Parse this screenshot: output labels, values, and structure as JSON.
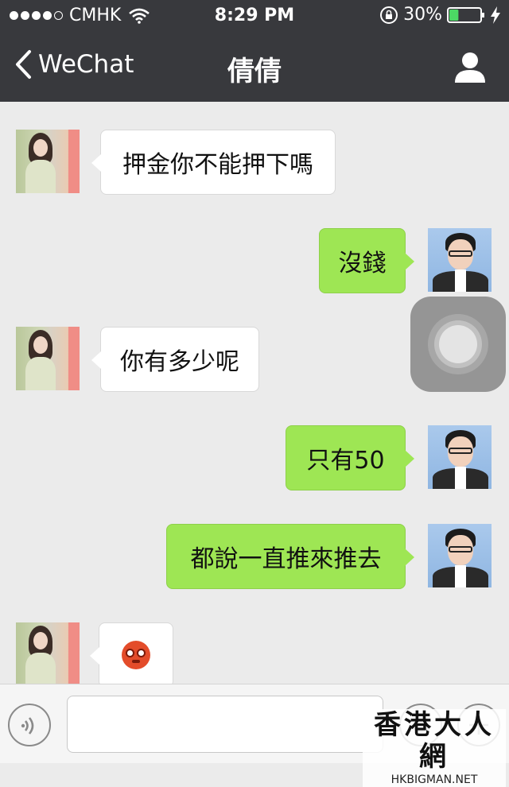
{
  "status_bar": {
    "signal_dots_filled": 4,
    "signal_dots_total": 5,
    "carrier": "CMHK",
    "time": "8:29 PM",
    "battery_percent": "30%",
    "battery_level": 0.3,
    "wifi_icon": "wifi-icon",
    "lock_icon": "rotation-lock-icon",
    "charging_icon": "bolt-icon"
  },
  "nav": {
    "back_label": "WeChat",
    "title": "倩倩",
    "profile_icon": "person-icon"
  },
  "messages": [
    {
      "sender": "contact",
      "text": "押金你不能押下嗎"
    },
    {
      "sender": "me",
      "text": "沒錢"
    },
    {
      "sender": "contact",
      "text": "你有多少呢"
    },
    {
      "sender": "me",
      "text": "只有50"
    },
    {
      "sender": "me",
      "text": "都說一直推來推去"
    },
    {
      "sender": "contact",
      "text": "",
      "emoji": "flushed-face-emoji"
    }
  ],
  "input_bar": {
    "placeholder": "",
    "voice_icon": "voice-icon",
    "emoji_icon": "smiley-icon",
    "plus_icon": "plus-icon"
  },
  "watermark": {
    "title": "香港大人網",
    "url": "HKBIGMAN.NET"
  },
  "colors": {
    "header_bg": "#38393d",
    "chat_bg": "#ebebeb",
    "outgoing_bubble": "#9ee654",
    "incoming_bubble": "#ffffff",
    "battery_fill": "#4cd964"
  }
}
